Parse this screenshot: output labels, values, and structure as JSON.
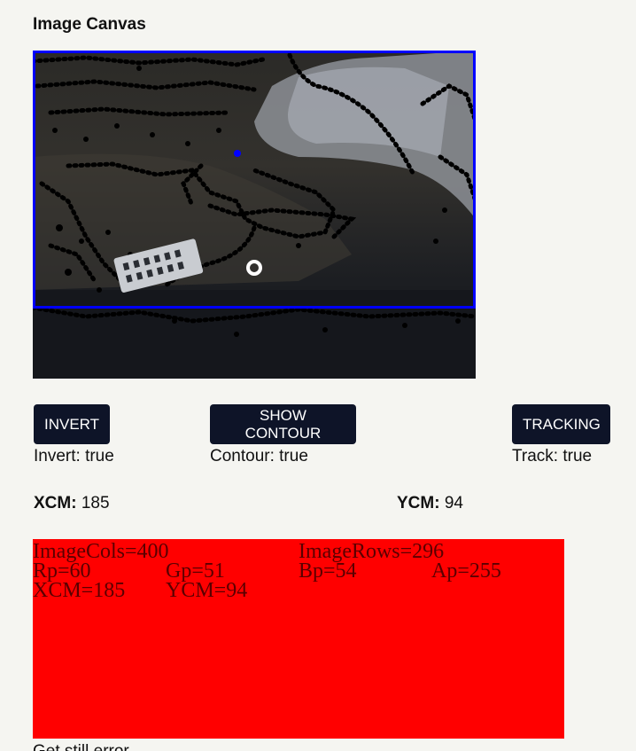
{
  "header": {
    "title": "Image Canvas"
  },
  "controls": {
    "invert_label": "INVERT",
    "contour_label": "SHOW CONTOUR",
    "tracking_label": "TRACKING",
    "invert_state": "Invert: true",
    "contour_state": "Contour: true",
    "track_state": "Track: true"
  },
  "centroid": {
    "xcm_label": "XCM:",
    "xcm_value": "185",
    "ycm_label": "YCM:",
    "ycm_value": "94"
  },
  "readout": {
    "image_cols": "ImageCols=400",
    "image_rows": "ImageRows=296",
    "rp": "Rp=60",
    "gp": "Gp=51",
    "bp": "Bp=54",
    "ap": "Ap=255",
    "xcm": "XCM=185",
    "ycm": "YCM=94"
  },
  "status": {
    "message": "Get still error"
  },
  "colors": {
    "button_bg": "#0e1428",
    "panel_bg": "#ff0000",
    "tracking_box": "#0000ff"
  }
}
